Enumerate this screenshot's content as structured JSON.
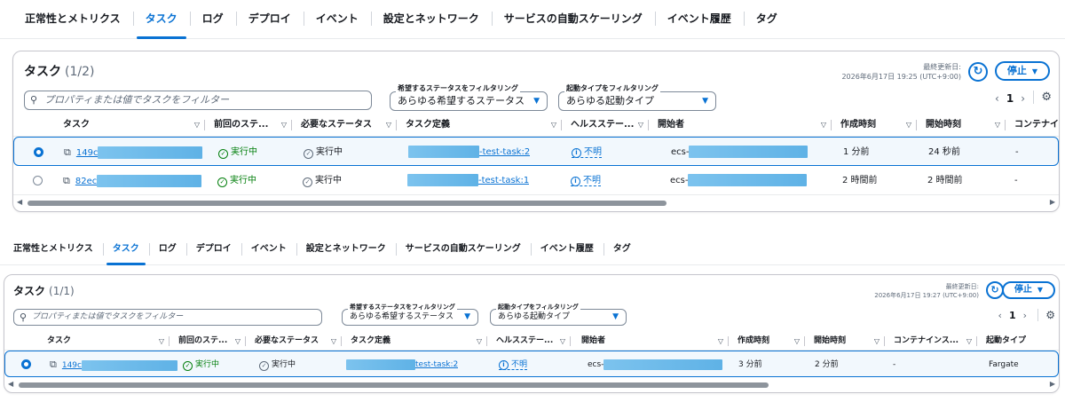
{
  "tabs": [
    "正常性とメトリクス",
    "タスク",
    "ログ",
    "デプロイ",
    "イベント",
    "設定とネットワーク",
    "サービスの自動スケーリング",
    "イベント履歴",
    "タグ"
  ],
  "active_tab": "タスク",
  "common": {
    "updated_label": "最終更新日:",
    "stop_label": "停止",
    "search_placeholder": "プロパティまたは値でタスクをフィルター",
    "filter_status_label": "希望するステータスをフィルタリング",
    "filter_status_value": "あらゆる希望するステータス",
    "filter_launch_label": "起動タイプをフィルタリング",
    "filter_launch_value": "あらゆる起動タイプ",
    "page": "1"
  },
  "panel1": {
    "title": "タスク",
    "count": "(1/2)",
    "updated_time": "2026年6月17日 19:25 (UTC+9:00)",
    "columns": [
      "タスク",
      "前回のステ...",
      "必要なステータス",
      "タスク定義",
      "ヘルスステー...",
      "開始者",
      "作成時刻",
      "開始時刻",
      "コンテナイ"
    ],
    "rows": [
      {
        "task": "149c",
        "last": "実行中",
        "desired": "実行中",
        "def": "-test-task:2",
        "health": "不明",
        "starter": "ecs-",
        "created": "1 分前",
        "started": "24 秒前",
        "container": "-"
      },
      {
        "task": "82ec",
        "last": "実行中",
        "desired": "実行中",
        "def": "-test-task:1",
        "health": "不明",
        "starter": "ecs-",
        "created": "2 時間前",
        "started": "2 時間前",
        "container": "-"
      }
    ]
  },
  "panel2": {
    "title": "タスク",
    "count": "(1/1)",
    "updated_time": "2026年6月17日 19:27 (UTC+9:00)",
    "columns": [
      "タスク",
      "前回のステ...",
      "必要なステータス",
      "タスク定義",
      "ヘルスステー...",
      "開始者",
      "作成時刻",
      "開始時刻",
      "コンテナインス...",
      "起動タイプ"
    ],
    "rows": [
      {
        "task": "149c",
        "last": "実行中",
        "desired": "実行中",
        "def": "test-task:2",
        "health": "不明",
        "starter": "ecs-",
        "created": "3 分前",
        "started": "2 分前",
        "container": "-",
        "launch": "Fargate"
      }
    ]
  }
}
